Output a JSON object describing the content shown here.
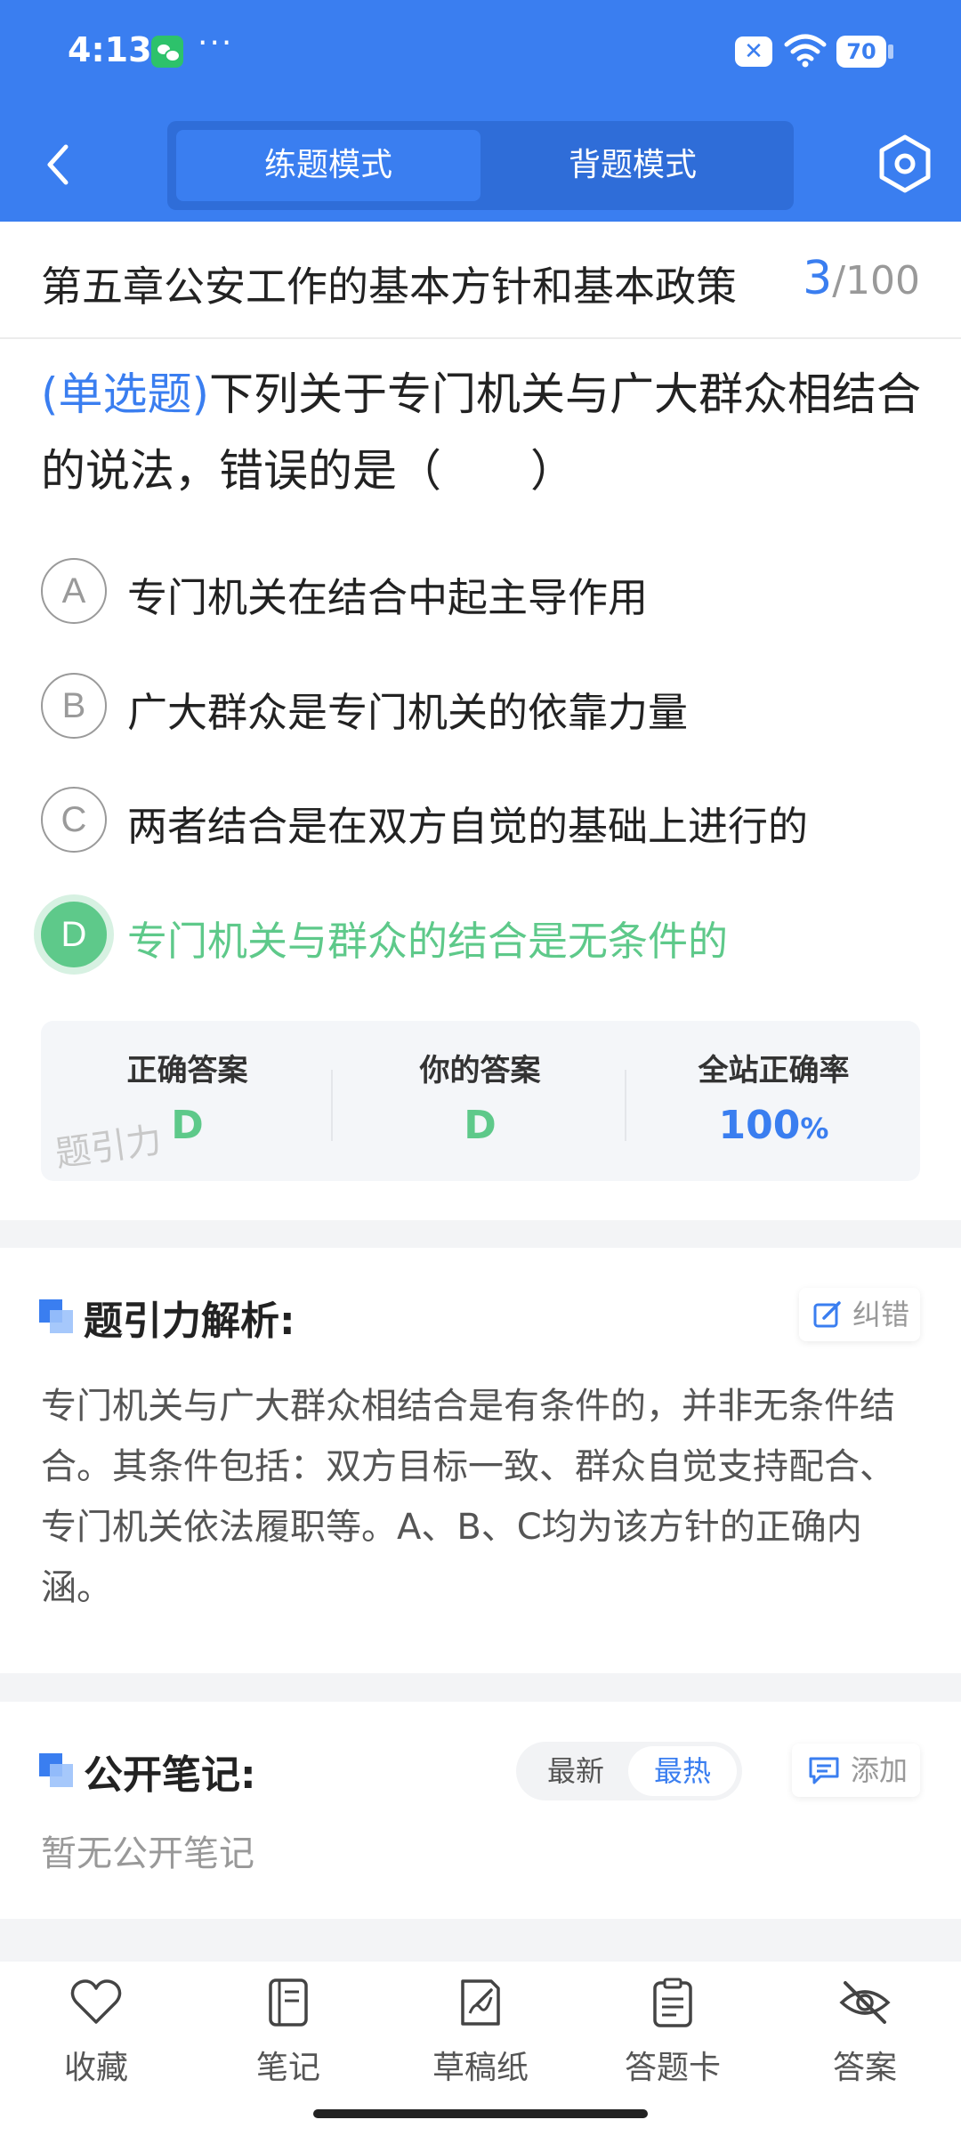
{
  "status_bar": {
    "time": "4:13",
    "dots": "···",
    "battery": "70"
  },
  "nav": {
    "modes": [
      "练题模式",
      "背题模式"
    ]
  },
  "question_header": {
    "chapter": "第五章公安工作的基本方针和基本政策",
    "current": "3",
    "total": "/100"
  },
  "question": {
    "type_label": "(单选题)",
    "text": "下列关于专门机关与广大群众相结合的说法，错误的是（　　）",
    "options": [
      {
        "key": "A",
        "text": "专门机关在结合中起主导作用"
      },
      {
        "key": "B",
        "text": "广大群众是专门机关的依靠力量"
      },
      {
        "key": "C",
        "text": "两者结合是在双方自觉的基础上进行的"
      },
      {
        "key": "D",
        "text": "专门机关与群众的结合是无条件的"
      }
    ],
    "selected": "D",
    "correct_color": "#5ec98a"
  },
  "result": {
    "correct_label": "正确答案",
    "correct_value": "D",
    "yours_label": "你的答案",
    "yours_value": "D",
    "rate_label": "全站正确率",
    "rate_value": "100",
    "rate_unit": "%",
    "watermark": "题引力"
  },
  "analysis": {
    "title": "题引力解析:",
    "fix_label": "纠错",
    "text": "专门机关与广大群众相结合是有条件的，并非无条件结合。其条件包括：双方目标一致、群众自觉支持配合、专门机关依法履职等。A、B、C均为该方针的正确内涵。"
  },
  "notes": {
    "title": "公开笔记:",
    "sort_options": [
      "最新",
      "最热"
    ],
    "active_sort": "最热",
    "add_label": "添加",
    "empty_text": "暂无公开笔记"
  },
  "tabbar": [
    {
      "label": "收藏",
      "icon": "heart-icon"
    },
    {
      "label": "笔记",
      "icon": "notebook-icon"
    },
    {
      "label": "草稿纸",
      "icon": "draft-paper-icon"
    },
    {
      "label": "答题卡",
      "icon": "answer-sheet-icon"
    },
    {
      "label": "答案",
      "icon": "eye-off-icon"
    }
  ],
  "colors": {
    "primary": "#3a7ef0",
    "correct": "#5ec98a",
    "background": "#f3f4f6"
  }
}
